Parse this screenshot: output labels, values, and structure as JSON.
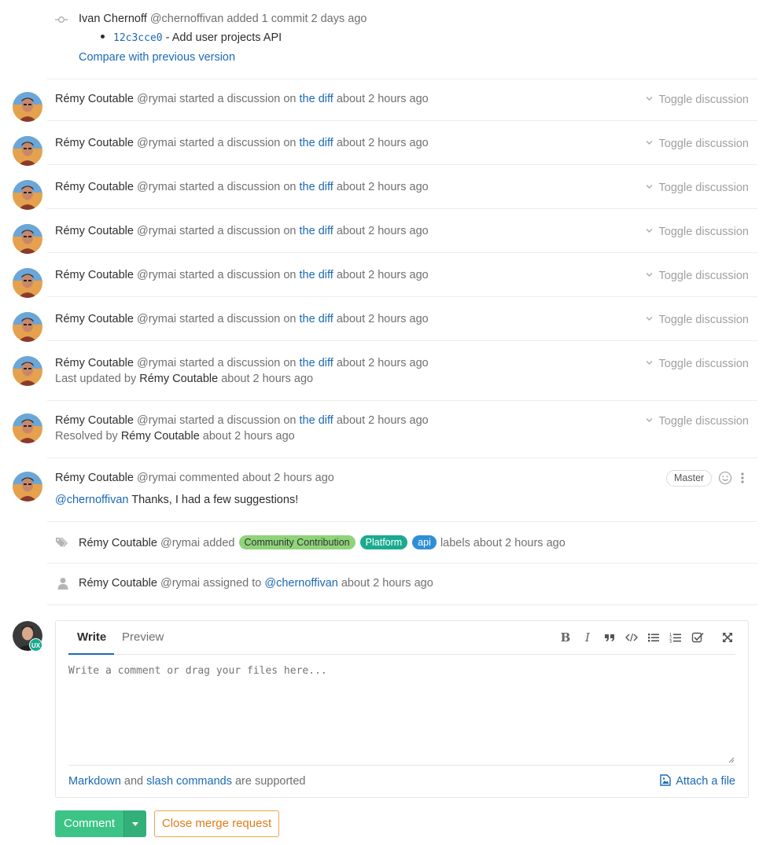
{
  "commit_note": {
    "author": "Ivan Chernoff",
    "handle": "@chernoffivan",
    "action": "added 1 commit",
    "time": "2 days ago",
    "sha": "12c3cce0",
    "message": "- Add user projects API",
    "compare_link": "Compare with previous version"
  },
  "discussions": [
    {
      "author": "Rémy Coutable",
      "handle": "@rymai",
      "action": "started a discussion on",
      "link": "the diff",
      "time": "about 2 hours ago",
      "toggle": "Toggle discussion"
    },
    {
      "author": "Rémy Coutable",
      "handle": "@rymai",
      "action": "started a discussion on",
      "link": "the diff",
      "time": "about 2 hours ago",
      "toggle": "Toggle discussion"
    },
    {
      "author": "Rémy Coutable",
      "handle": "@rymai",
      "action": "started a discussion on",
      "link": "the diff",
      "time": "about 2 hours ago",
      "toggle": "Toggle discussion"
    },
    {
      "author": "Rémy Coutable",
      "handle": "@rymai",
      "action": "started a discussion on",
      "link": "the diff",
      "time": "about 2 hours ago",
      "toggle": "Toggle discussion"
    },
    {
      "author": "Rémy Coutable",
      "handle": "@rymai",
      "action": "started a discussion on",
      "link": "the diff",
      "time": "about 2 hours ago",
      "toggle": "Toggle discussion"
    },
    {
      "author": "Rémy Coutable",
      "handle": "@rymai",
      "action": "started a discussion on",
      "link": "the diff",
      "time": "about 2 hours ago",
      "toggle": "Toggle discussion"
    },
    {
      "author": "Rémy Coutable",
      "handle": "@rymai",
      "action": "started a discussion on",
      "link": "the diff",
      "time": "about 2 hours ago",
      "toggle": "Toggle discussion",
      "sub_prefix": "Last updated by",
      "sub_author": "Rémy Coutable",
      "sub_time": "about 2 hours ago"
    },
    {
      "author": "Rémy Coutable",
      "handle": "@rymai",
      "action": "started a discussion on",
      "link": "the diff",
      "time": "about 2 hours ago",
      "toggle": "Toggle discussion",
      "sub_prefix": "Resolved by",
      "sub_author": "Rémy Coutable",
      "sub_time": "about 2 hours ago"
    }
  ],
  "comment": {
    "author": "Rémy Coutable",
    "handle": "@rymai",
    "action": "commented",
    "time": "about 2 hours ago",
    "role_badge": "Master",
    "mention": "@chernoffivan",
    "body": "Thanks, I had a few suggestions!"
  },
  "labels_note": {
    "author": "Rémy Coutable",
    "handle": "@rymai",
    "action": "added",
    "labels": [
      "Community Contribution",
      "Platform",
      "api"
    ],
    "suffix": "labels about 2 hours ago"
  },
  "assign_note": {
    "author": "Rémy Coutable",
    "handle": "@rymai",
    "action": "assigned to",
    "assignee": "@chernoffivan",
    "time": "about 2 hours ago"
  },
  "form": {
    "tab_write": "Write",
    "tab_preview": "Preview",
    "placeholder": "Write a comment or drag your files here...",
    "footer_markdown": "Markdown",
    "footer_and": "and",
    "footer_slash": "slash commands",
    "footer_suffix": "are supported",
    "attach": "Attach a file",
    "avatar_badge": "UX"
  },
  "actions": {
    "comment": "Comment",
    "close": "Close merge request"
  },
  "colors": {
    "link": "#1b69b6",
    "comment_button": "#3cc487",
    "close_button": "#e07a16",
    "label_community": "#8fd37a",
    "label_platform": "#1aaa8f",
    "label_api": "#2f8fd6"
  }
}
